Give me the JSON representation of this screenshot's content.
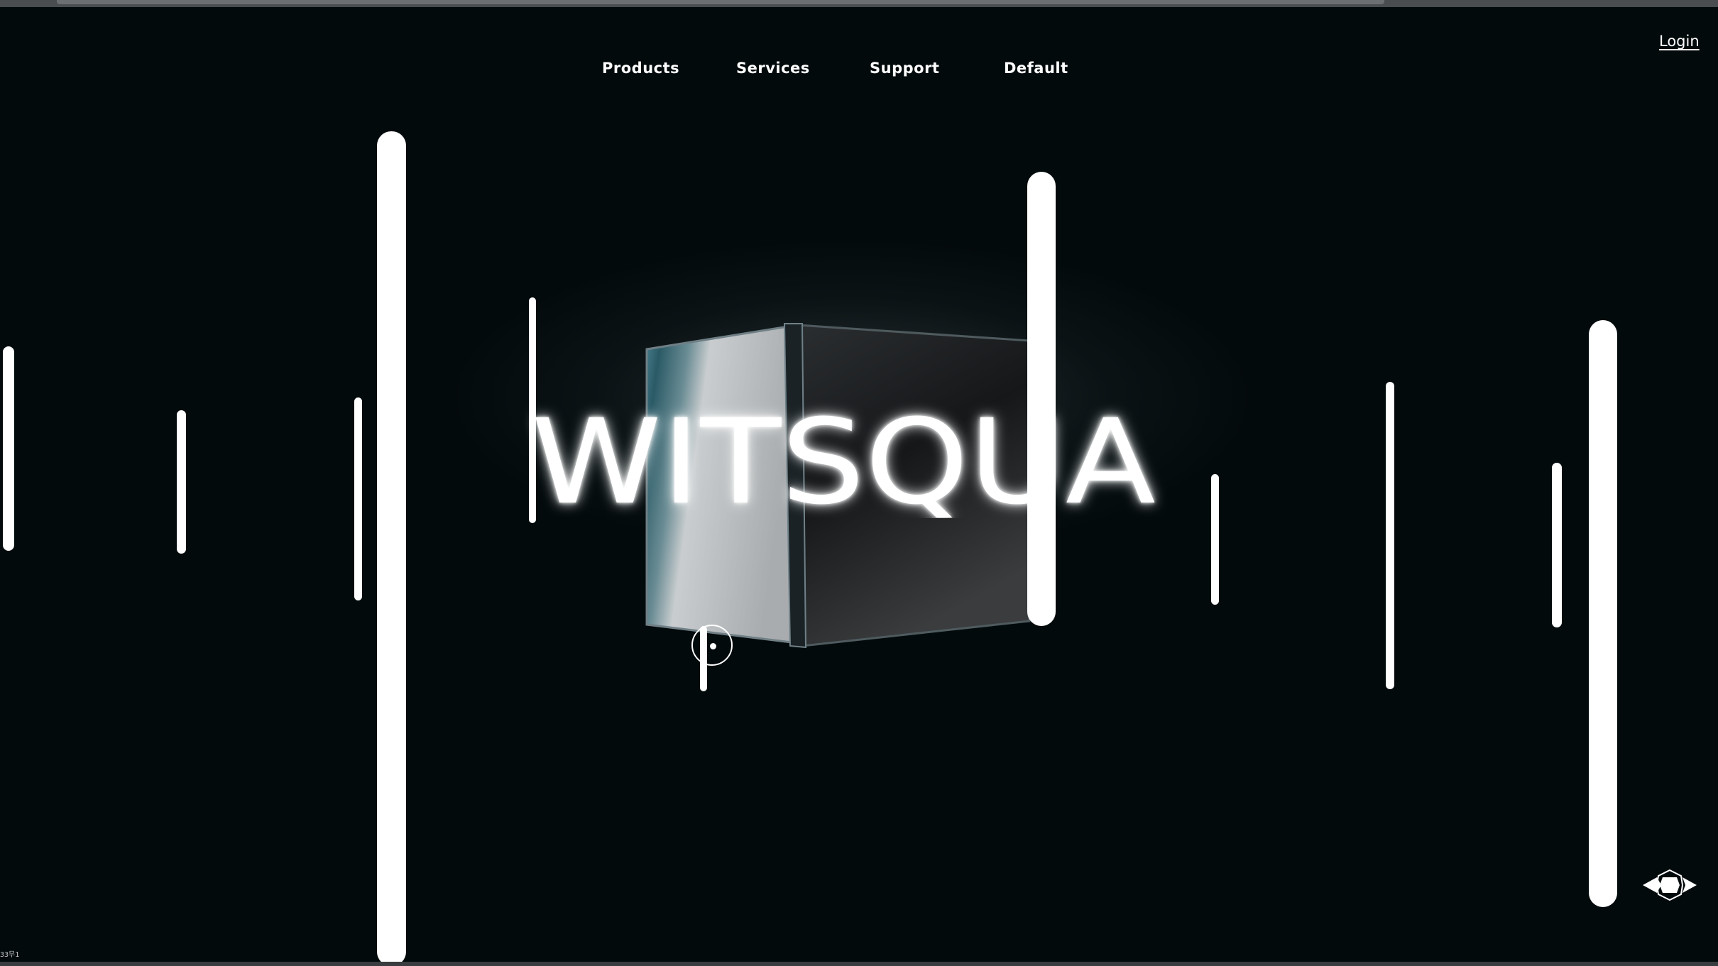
{
  "nav": {
    "items": [
      {
        "label": "Products"
      },
      {
        "label": "Services"
      },
      {
        "label": "Support"
      },
      {
        "label": "Default"
      }
    ],
    "login_label": "Login"
  },
  "hero": {
    "brand": "WITSQUA"
  },
  "status": {
    "text": "33무1"
  },
  "colors": {
    "background": "#030a0c",
    "foreground": "#ffffff"
  },
  "icons": {
    "corner": "eye-logo-icon",
    "cursor": "circle-cursor-icon"
  }
}
